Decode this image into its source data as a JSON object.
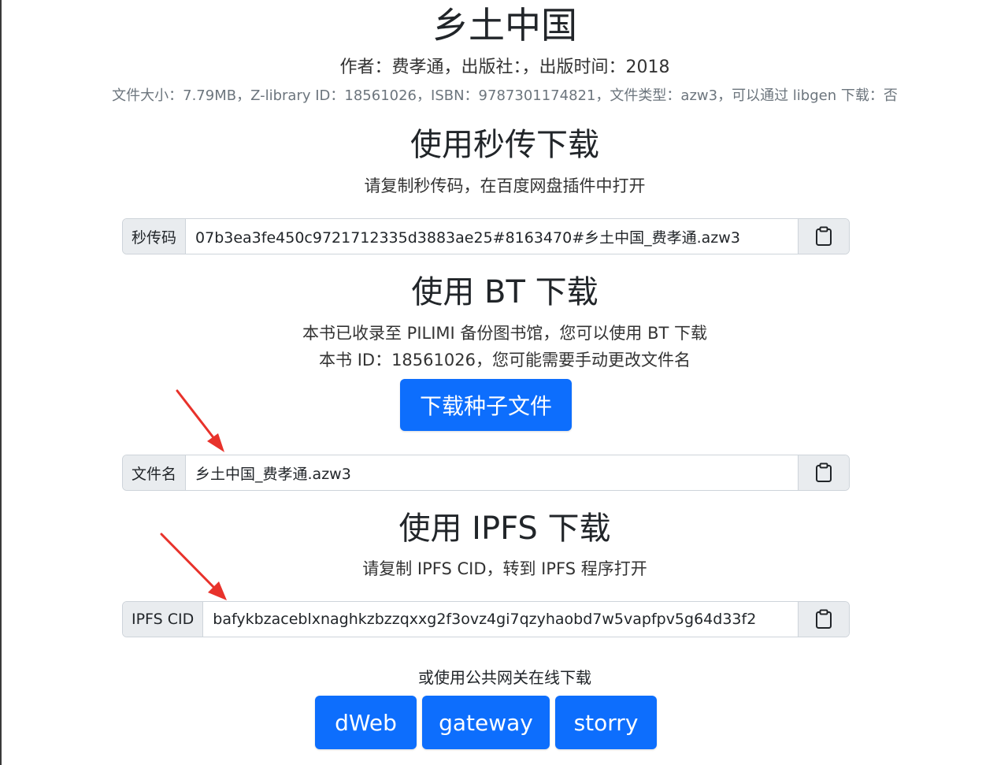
{
  "book": {
    "title": "乡土中国",
    "meta_line": "作者：费孝通，出版社：，出版时间：2018",
    "info_line": "文件大小：7.79MB，Z-library ID：18561026，ISBN：9787301174821，文件类型：azw3，可以通过 libgen 下载：否"
  },
  "rapid": {
    "heading": "使用秒传下载",
    "hint": "请复制秒传码，在百度网盘插件中打开",
    "label": "秒传码",
    "value": "07b3ea3fe450c9721712335d3883ae25#8163470#乡土中国_费孝通.azw3"
  },
  "bt": {
    "heading": "使用 BT 下载",
    "line1": "本书已收录至 PILIMI 备份图书馆，您可以使用 BT 下载",
    "line2": "本书 ID：18561026，您可能需要手动更改文件名",
    "button_label": "下载种子文件",
    "filename_label": "文件名",
    "filename_value": "乡土中国_费孝通.azw3"
  },
  "ipfs": {
    "heading": "使用 IPFS 下载",
    "hint": "请复制 IPFS CID，转到 IPFS 程序打开",
    "cid_label": "IPFS CID",
    "cid_value": "bafykbzaceblxnaghkzbzzqxxg2f3ovz4gi7qzyhaobd7w5vapfpv5g64d33f2",
    "gateway_hint": "或使用公共网关在线下载",
    "gateways": [
      "dWeb",
      "gateway",
      "storry"
    ]
  },
  "icons": {
    "copy": "clipboard-icon",
    "annotation": "red-arrow-icon"
  },
  "colors": {
    "primary": "#0d6efd",
    "annotation": "#e8322b",
    "addon_bg": "#e9ecef"
  }
}
